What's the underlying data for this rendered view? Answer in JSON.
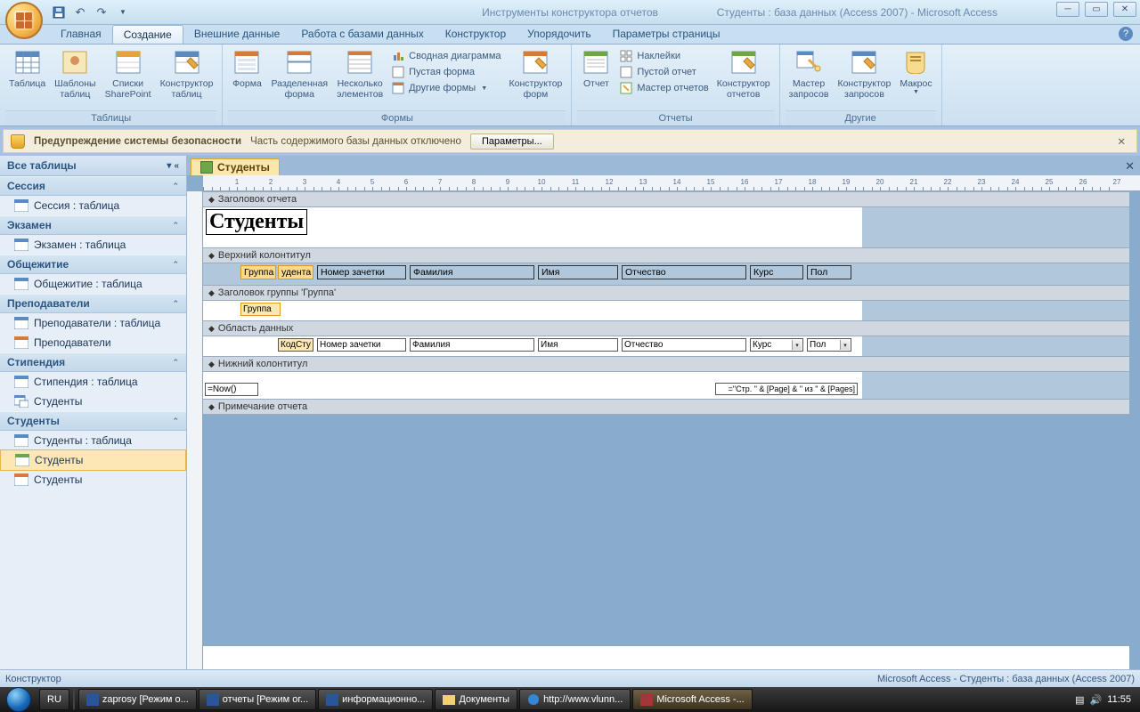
{
  "titlebar": {
    "context_title": "Инструменты конструктора отчетов",
    "window_title": "Студенты : база данных (Access 2007) - Microsoft Access"
  },
  "tabs": {
    "home": "Главная",
    "create": "Создание",
    "external": "Внешние данные",
    "db_tools": "Работа с базами данных",
    "design": "Конструктор",
    "arrange": "Упорядочить",
    "page_setup": "Параметры страницы"
  },
  "ribbon": {
    "g_tables": {
      "label": "Таблицы",
      "table": "Таблица",
      "templates": "Шаблоны\nтаблиц",
      "sharepoint": "Списки\nSharePoint",
      "designer": "Конструктор\nтаблиц"
    },
    "g_forms": {
      "label": "Формы",
      "form": "Форма",
      "split": "Разделенная\nформа",
      "multi": "Несколько\nэлементов",
      "pivot": "Сводная диаграмма",
      "blank": "Пустая форма",
      "other": "Другие формы",
      "designer": "Конструктор\nформ"
    },
    "g_reports": {
      "label": "Отчеты",
      "report": "Отчет",
      "labels": "Наклейки",
      "blank": "Пустой отчет",
      "wizard": "Мастер отчетов",
      "designer": "Конструктор\nотчетов"
    },
    "g_other": {
      "label": "Другие",
      "qwizard": "Мастер\nзапросов",
      "qdesign": "Конструктор\nзапросов",
      "macro": "Макрос"
    }
  },
  "security": {
    "title": "Предупреждение системы безопасности",
    "msg": "Часть содержимого базы данных отключено",
    "btn": "Параметры..."
  },
  "nav": {
    "header": "Все таблицы",
    "sessia": {
      "hdr": "Сессия",
      "t": "Сессия : таблица"
    },
    "ekzamen": {
      "hdr": "Экзамен",
      "t": "Экзамен : таблица"
    },
    "obsh": {
      "hdr": "Общежитие",
      "t": "Общежитие : таблица"
    },
    "prep": {
      "hdr": "Преподаватели",
      "t1": "Преподаватели : таблица",
      "t2": "Преподаватели"
    },
    "stip": {
      "hdr": "Стипендия",
      "t1": "Стипендия : таблица",
      "t2": "Студенты"
    },
    "stud": {
      "hdr": "Студенты",
      "t1": "Студенты : таблица",
      "t2": "Студенты",
      "t3": "Студенты"
    }
  },
  "doc_tab": "Студенты",
  "report": {
    "sec_header": "Заголовок отчета",
    "title": "Студенты",
    "sec_page_hdr": "Верхний колонтитул",
    "cols": {
      "gruppa": "Группа",
      "udenta": "удента",
      "nomer": "Номер зачетки",
      "fam": "Фамилия",
      "imya": "Имя",
      "otch": "Отчество",
      "kurs": "Курс",
      "pol": "Пол"
    },
    "sec_group_hdr": "Заголовок группы 'Группа'",
    "grp_field": "Группа",
    "sec_detail": "Область данных",
    "detail": {
      "kod": "КодСту",
      "nomer": "Номер зачетки",
      "fam": "Фамилия",
      "imya": "Имя",
      "otch": "Отчество",
      "kurs": "Курс",
      "pol": "Пол"
    },
    "sec_page_ftr": "Нижний колонтитул",
    "now_expr": "=Now()",
    "page_expr": "=\"Стр. \" & [Page] & \" из \" & [Pages]",
    "sec_footer": "Примечание отчета"
  },
  "statusbar": {
    "mode": "Конструктор",
    "right": "Microsoft Access - Студенты : база данных (Access 2007)"
  },
  "taskbar": {
    "lang": "RU",
    "b1": "zaprosy [Режим о...",
    "b2": "отчеты [Режим ог...",
    "b3": "информационно...",
    "b4": "Документы",
    "b5": "http://www.vlunn...",
    "b6": "Microsoft Access -...",
    "time": "11:55"
  }
}
